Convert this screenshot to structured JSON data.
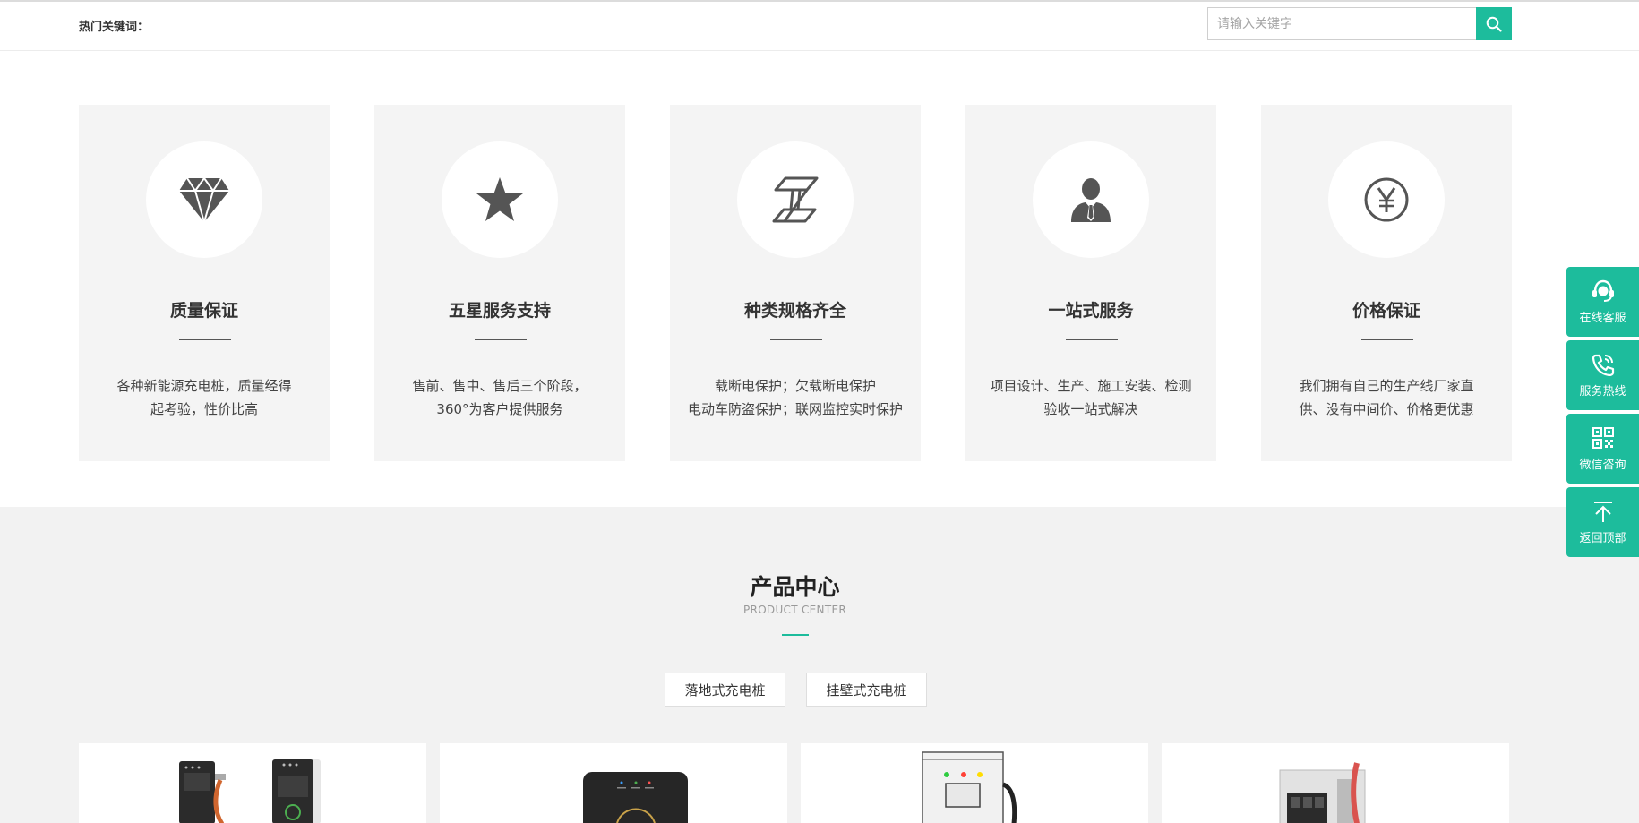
{
  "header": {
    "hot_keywords_label": "热门关键词：",
    "search": {
      "placeholder": "请输入关键字",
      "value": ""
    }
  },
  "features": [
    {
      "icon": "diamond-icon",
      "title": "质量保证",
      "desc_line1": "各种新能源充电桩，质量经得",
      "desc_line2": "起考验，性价比高"
    },
    {
      "icon": "star-icon",
      "title": "五星服务支持",
      "desc_line1": "售前、售中、售后三个阶段，",
      "desc_line2": "360°为客户提供服务"
    },
    {
      "icon": "steel-beam-icon",
      "title": "种类规格齐全",
      "desc_line1": "载断电保护；欠载断电保护",
      "desc_line2": "电动车防盗保护；联网监控实时保护"
    },
    {
      "icon": "businessman-icon",
      "title": "一站式服务",
      "desc_line1": "项目设计、生产、施工安装、检测",
      "desc_line2": "验收一站式解决"
    },
    {
      "icon": "yen-icon",
      "title": "价格保证",
      "desc_line1": "我们拥有自己的生产线厂家直",
      "desc_line2": "供、没有中间价、价格更优惠"
    }
  ],
  "product_center": {
    "title": "产品中心",
    "subtitle": "PRODUCT CENTER",
    "tabs": [
      {
        "label": "落地式充电桩"
      },
      {
        "label": "挂壁式充电桩"
      }
    ]
  },
  "float_bar": [
    {
      "icon": "customer-service-icon",
      "label": "在线客服"
    },
    {
      "icon": "phone-icon",
      "label": "服务热线"
    },
    {
      "icon": "qr-code-icon",
      "label": "微信咨询"
    },
    {
      "icon": "back-to-top-icon",
      "label": "返回顶部"
    }
  ],
  "colors": {
    "accent": "#1dbc9c",
    "card_bg": "#f4f4f4",
    "section_bg": "#f2f2f2",
    "icon_gray": "#555555"
  }
}
